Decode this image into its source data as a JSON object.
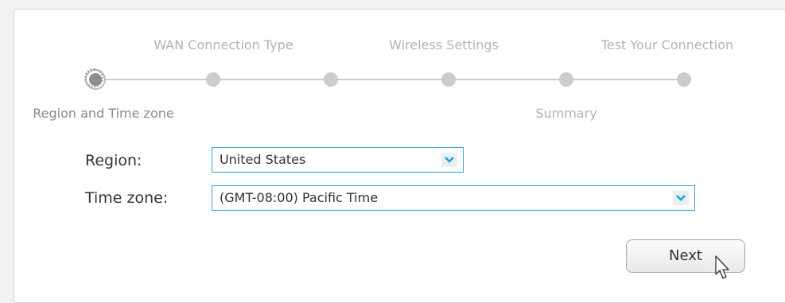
{
  "wizard": {
    "steps": [
      {
        "label": "Region and Time zone",
        "position": "bottom",
        "state": "current"
      },
      {
        "label": "WAN Connection Type",
        "position": "top",
        "state": "pending"
      },
      {
        "label": "",
        "position": "bottom",
        "state": "pending"
      },
      {
        "label": "Wireless Settings",
        "position": "top",
        "state": "pending"
      },
      {
        "label": "Summary",
        "position": "bottom",
        "state": "pending"
      },
      {
        "label": "Test Your Connection",
        "position": "top",
        "state": "pending"
      }
    ],
    "current_step": 1,
    "total_steps": 6
  },
  "form": {
    "region": {
      "label": "Region:",
      "value": "United States"
    },
    "timezone": {
      "label": "Time zone:",
      "value": "(GMT-08:00) Pacific Time"
    }
  },
  "actions": {
    "next_label": "Next"
  },
  "icons": {
    "select_arrow": "chevron-down-icon",
    "cursor": "mouse-pointer-icon"
  },
  "colors": {
    "accent": "#29a8df",
    "dot_inactive": "#cccccc",
    "dot_active": "#8c8c8c"
  }
}
